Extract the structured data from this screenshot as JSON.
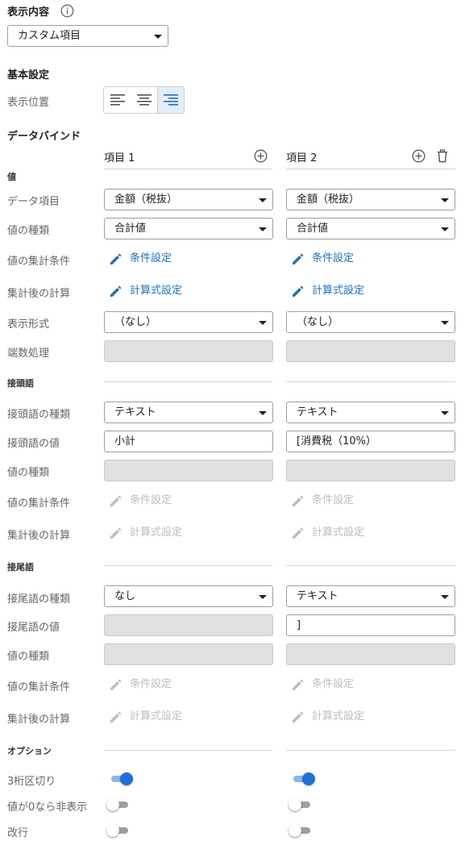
{
  "display_content": {
    "title": "表示内容",
    "selected": "カスタム項目"
  },
  "basic_settings": {
    "title": "基本設定",
    "position_label": "表示位置",
    "align_options": [
      "left-align-icon",
      "center-align-icon",
      "right-align-icon"
    ],
    "selected_align": "right"
  },
  "databind": {
    "title": "データバインド",
    "columns": [
      {
        "header": "項目 1"
      },
      {
        "header": "項目 2"
      }
    ]
  },
  "sections": {
    "value": "値",
    "prefix": "接頭語",
    "suffix": "接尾語",
    "options": "オプション"
  },
  "labels": {
    "data_item": "データ項目",
    "value_type": "値の種類",
    "agg_condition": "値の集計条件",
    "post_calc": "集計後の計算",
    "display_format": "表示形式",
    "rounding": "端数処理",
    "prefix_type": "接頭語の種類",
    "prefix_value": "接頭語の値",
    "suffix_type": "接尾語の種類",
    "suffix_value": "接尾語の値",
    "thousands_sep": "3桁区切り",
    "hide_zero": "値が0なら非表示",
    "line_break": "改行"
  },
  "links": {
    "condition": "条件設定",
    "formula": "計算式設定"
  },
  "col1": {
    "data_item": "金額（税抜）",
    "value_type": "合計値",
    "display_format": "（なし）",
    "prefix_type": "テキスト",
    "prefix_value": "小計",
    "suffix_type": "なし",
    "thousands_sep": true,
    "hide_zero": false,
    "line_break": false
  },
  "col2": {
    "data_item": "金額（税抜）",
    "value_type": "合計値",
    "display_format": "（なし）",
    "prefix_type": "テキスト",
    "prefix_value": "[消費税（10%）",
    "suffix_type": "テキスト",
    "suffix_value": "]",
    "thousands_sep": true,
    "hide_zero": false,
    "line_break": false
  },
  "colors": {
    "accent": "#1e73be",
    "toggle_on": "#1e6fd9",
    "disabled_bg": "#e0e0e0"
  }
}
